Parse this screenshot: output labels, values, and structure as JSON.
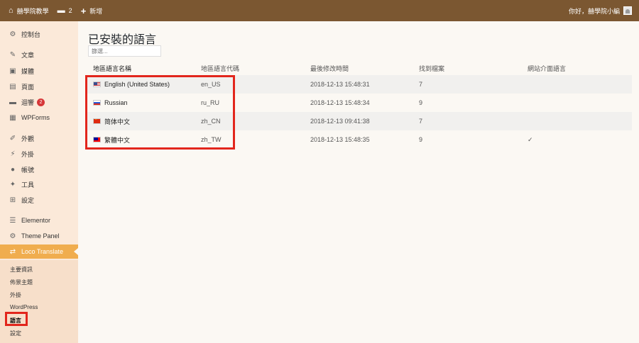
{
  "topbar": {
    "site_name": "囍學院教學",
    "comments_count": "2",
    "new_label": "新增",
    "greeting": "你好，囍學院小編"
  },
  "sidebar": {
    "items": [
      {
        "icon": "dashboard-icon",
        "glyph": "⚙",
        "label": "控制台"
      },
      {
        "icon": "pin-icon",
        "glyph": "✎",
        "label": "文章"
      },
      {
        "icon": "media-icon",
        "glyph": "▣",
        "label": "媒體"
      },
      {
        "icon": "page-icon",
        "glyph": "▤",
        "label": "頁面"
      },
      {
        "icon": "comment-icon",
        "glyph": "▬",
        "label": "迴響",
        "badge": "2"
      },
      {
        "icon": "wpforms-icon",
        "glyph": "▦",
        "label": "WPForms"
      },
      {
        "icon": "appearance-icon",
        "glyph": "✐",
        "label": "外觀"
      },
      {
        "icon": "plugin-icon",
        "glyph": "⚡",
        "label": "外掛"
      },
      {
        "icon": "user-icon",
        "glyph": "●",
        "label": "帳號"
      },
      {
        "icon": "tools-icon",
        "glyph": "✦",
        "label": "工具"
      },
      {
        "icon": "settings-icon",
        "glyph": "⊞",
        "label": "設定"
      },
      {
        "icon": "elementor-icon",
        "glyph": "☰",
        "label": "Elementor"
      },
      {
        "icon": "gear-icon",
        "glyph": "⚙",
        "label": "Theme Panel"
      },
      {
        "icon": "translate-icon",
        "glyph": "⇄",
        "label": "Loco Translate"
      }
    ],
    "submenu": [
      "主要資訊",
      "佈景主題",
      "外掛",
      "WordPress",
      "語言",
      "設定"
    ]
  },
  "main": {
    "title": "已安裝的語言",
    "filter_placeholder": "篩選...",
    "columns": [
      "地區語言名稱",
      "地區語言代碼",
      "最後修改時間",
      "找到檔案",
      "網站介面語言"
    ],
    "rows": [
      {
        "flag": "us-flag-icon",
        "name": "English (United States)",
        "code": "en_US",
        "modified": "2018-12-13 15:48:31",
        "files": "7",
        "site": ""
      },
      {
        "flag": "ru-flag-icon",
        "name": "Russian",
        "code": "ru_RU",
        "modified": "2018-12-13 15:48:34",
        "files": "9",
        "site": ""
      },
      {
        "flag": "cn-flag-icon",
        "name": "简体中文",
        "code": "zh_CN",
        "modified": "2018-12-13 09:41:38",
        "files": "7",
        "site": ""
      },
      {
        "flag": "tw-flag-icon",
        "name": "繁體中文",
        "code": "zh_TW",
        "modified": "2018-12-13 15:48:35",
        "files": "9",
        "site": "✓"
      }
    ]
  }
}
